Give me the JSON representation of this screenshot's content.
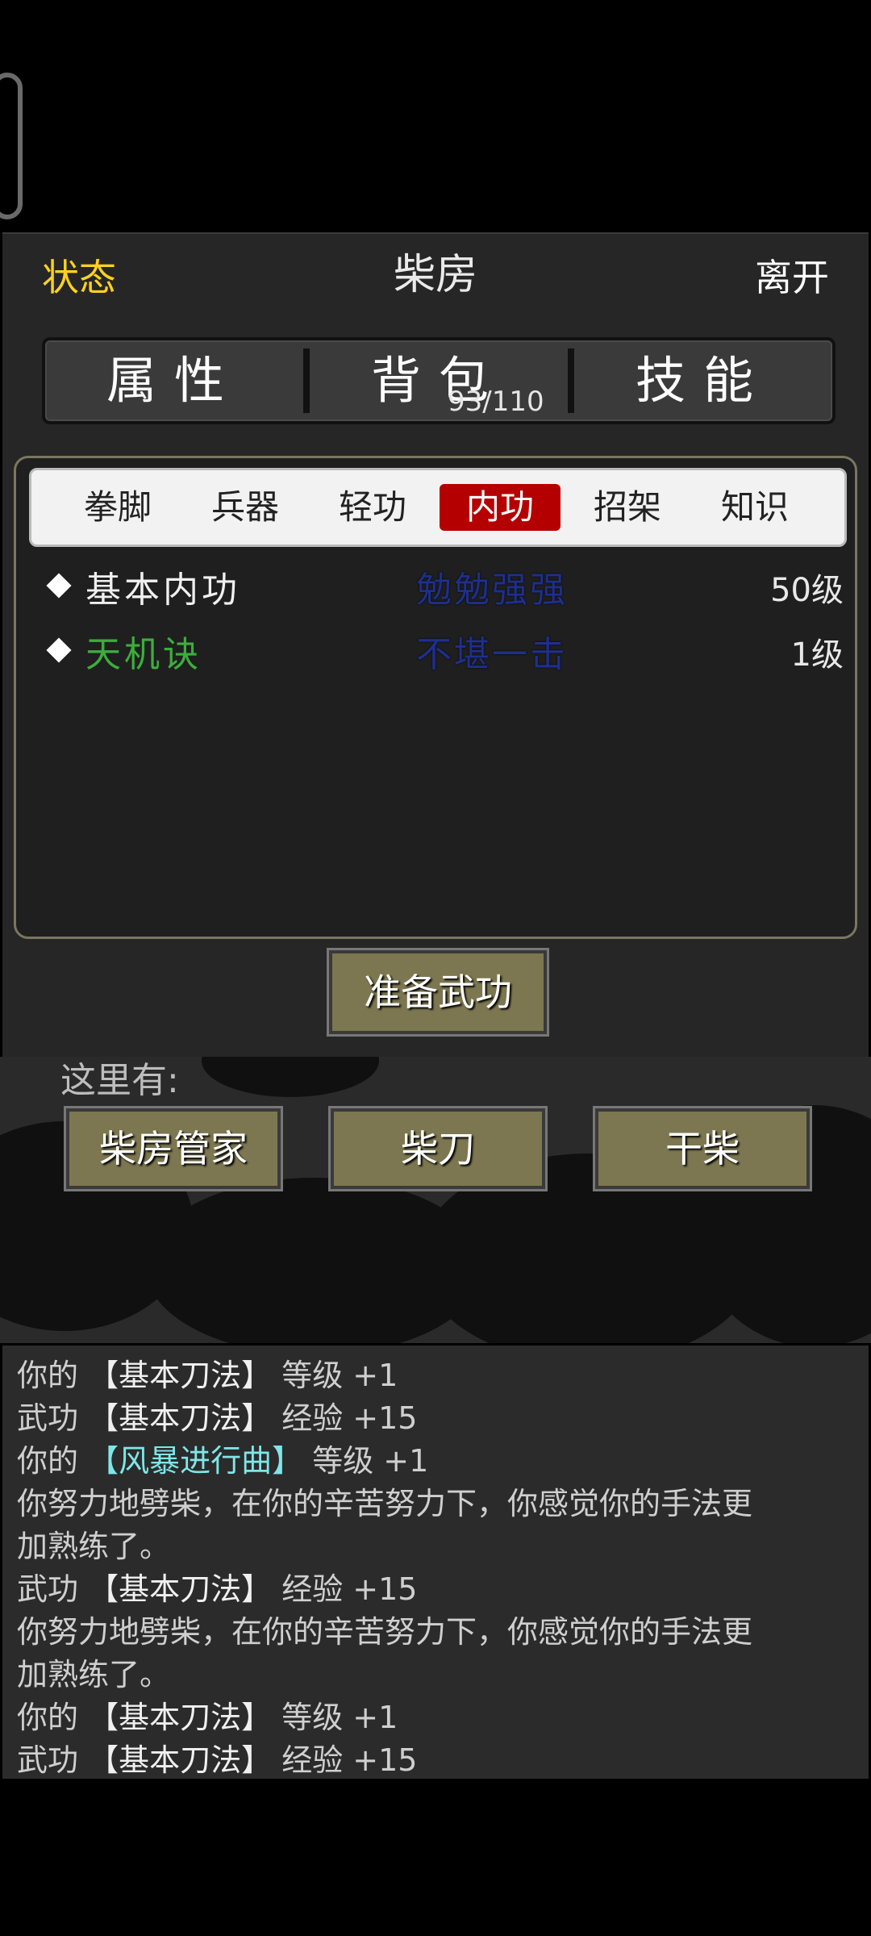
{
  "header": {
    "status_label": "状态",
    "title": "柴房",
    "leave_label": "离开"
  },
  "main_tabs": [
    {
      "label": "属性"
    },
    {
      "label": "背包"
    },
    {
      "label": "技能"
    }
  ],
  "bag_count": "93/110",
  "sub_tabs": [
    {
      "label": "拳脚"
    },
    {
      "label": "兵器"
    },
    {
      "label": "轻功"
    },
    {
      "label": "内功"
    },
    {
      "label": "招架"
    },
    {
      "label": "知识"
    }
  ],
  "active_sub_tab": "内功",
  "skills": [
    {
      "name": "基本内功",
      "rank": "勉勉强强",
      "level": "50级",
      "name_color": "#f0f0f0"
    },
    {
      "name": "天机诀",
      "rank": "不堪一击",
      "level": "1级",
      "name_color": "#3cae3c"
    }
  ],
  "prepare_button": "准备武功",
  "here": {
    "label": "这里有:",
    "items": [
      {
        "label": "柴房管家"
      },
      {
        "label": "柴刀"
      },
      {
        "label": "干柴"
      }
    ]
  },
  "log": [
    {
      "pre": "你的 ",
      "skill": "【基本刀法】",
      "post": " 等级 +1"
    },
    {
      "pre": "武功 ",
      "skill": "【基本刀法】",
      "post": " 经验 +15"
    },
    {
      "pre": "你的 ",
      "skill": "【风暴进行曲】",
      "post": " 等级 +1"
    },
    {
      "pre": "你努力地劈柴，在你的辛苦努力下，你感觉你的手法更",
      "skill": "",
      "post": ""
    },
    {
      "pre": "加熟练了。",
      "skill": "",
      "post": ""
    },
    {
      "pre": "武功 ",
      "skill": "【基本刀法】",
      "post": " 经验 +15"
    },
    {
      "pre": "你努力地劈柴，在你的辛苦努力下，你感觉你的手法更",
      "skill": "",
      "post": ""
    },
    {
      "pre": "加熟练了。",
      "skill": "",
      "post": ""
    },
    {
      "pre": "你的 ",
      "skill": "【基本刀法】",
      "post": " 等级 +1"
    },
    {
      "pre": "武功 ",
      "skill": "【基本刀法】",
      "post": " 经验 +15"
    }
  ],
  "colors": {
    "status": "#ffd21f",
    "active_tab": "#b40000",
    "button": "#7c7750",
    "highlight_skill": "#7fe6e8"
  }
}
